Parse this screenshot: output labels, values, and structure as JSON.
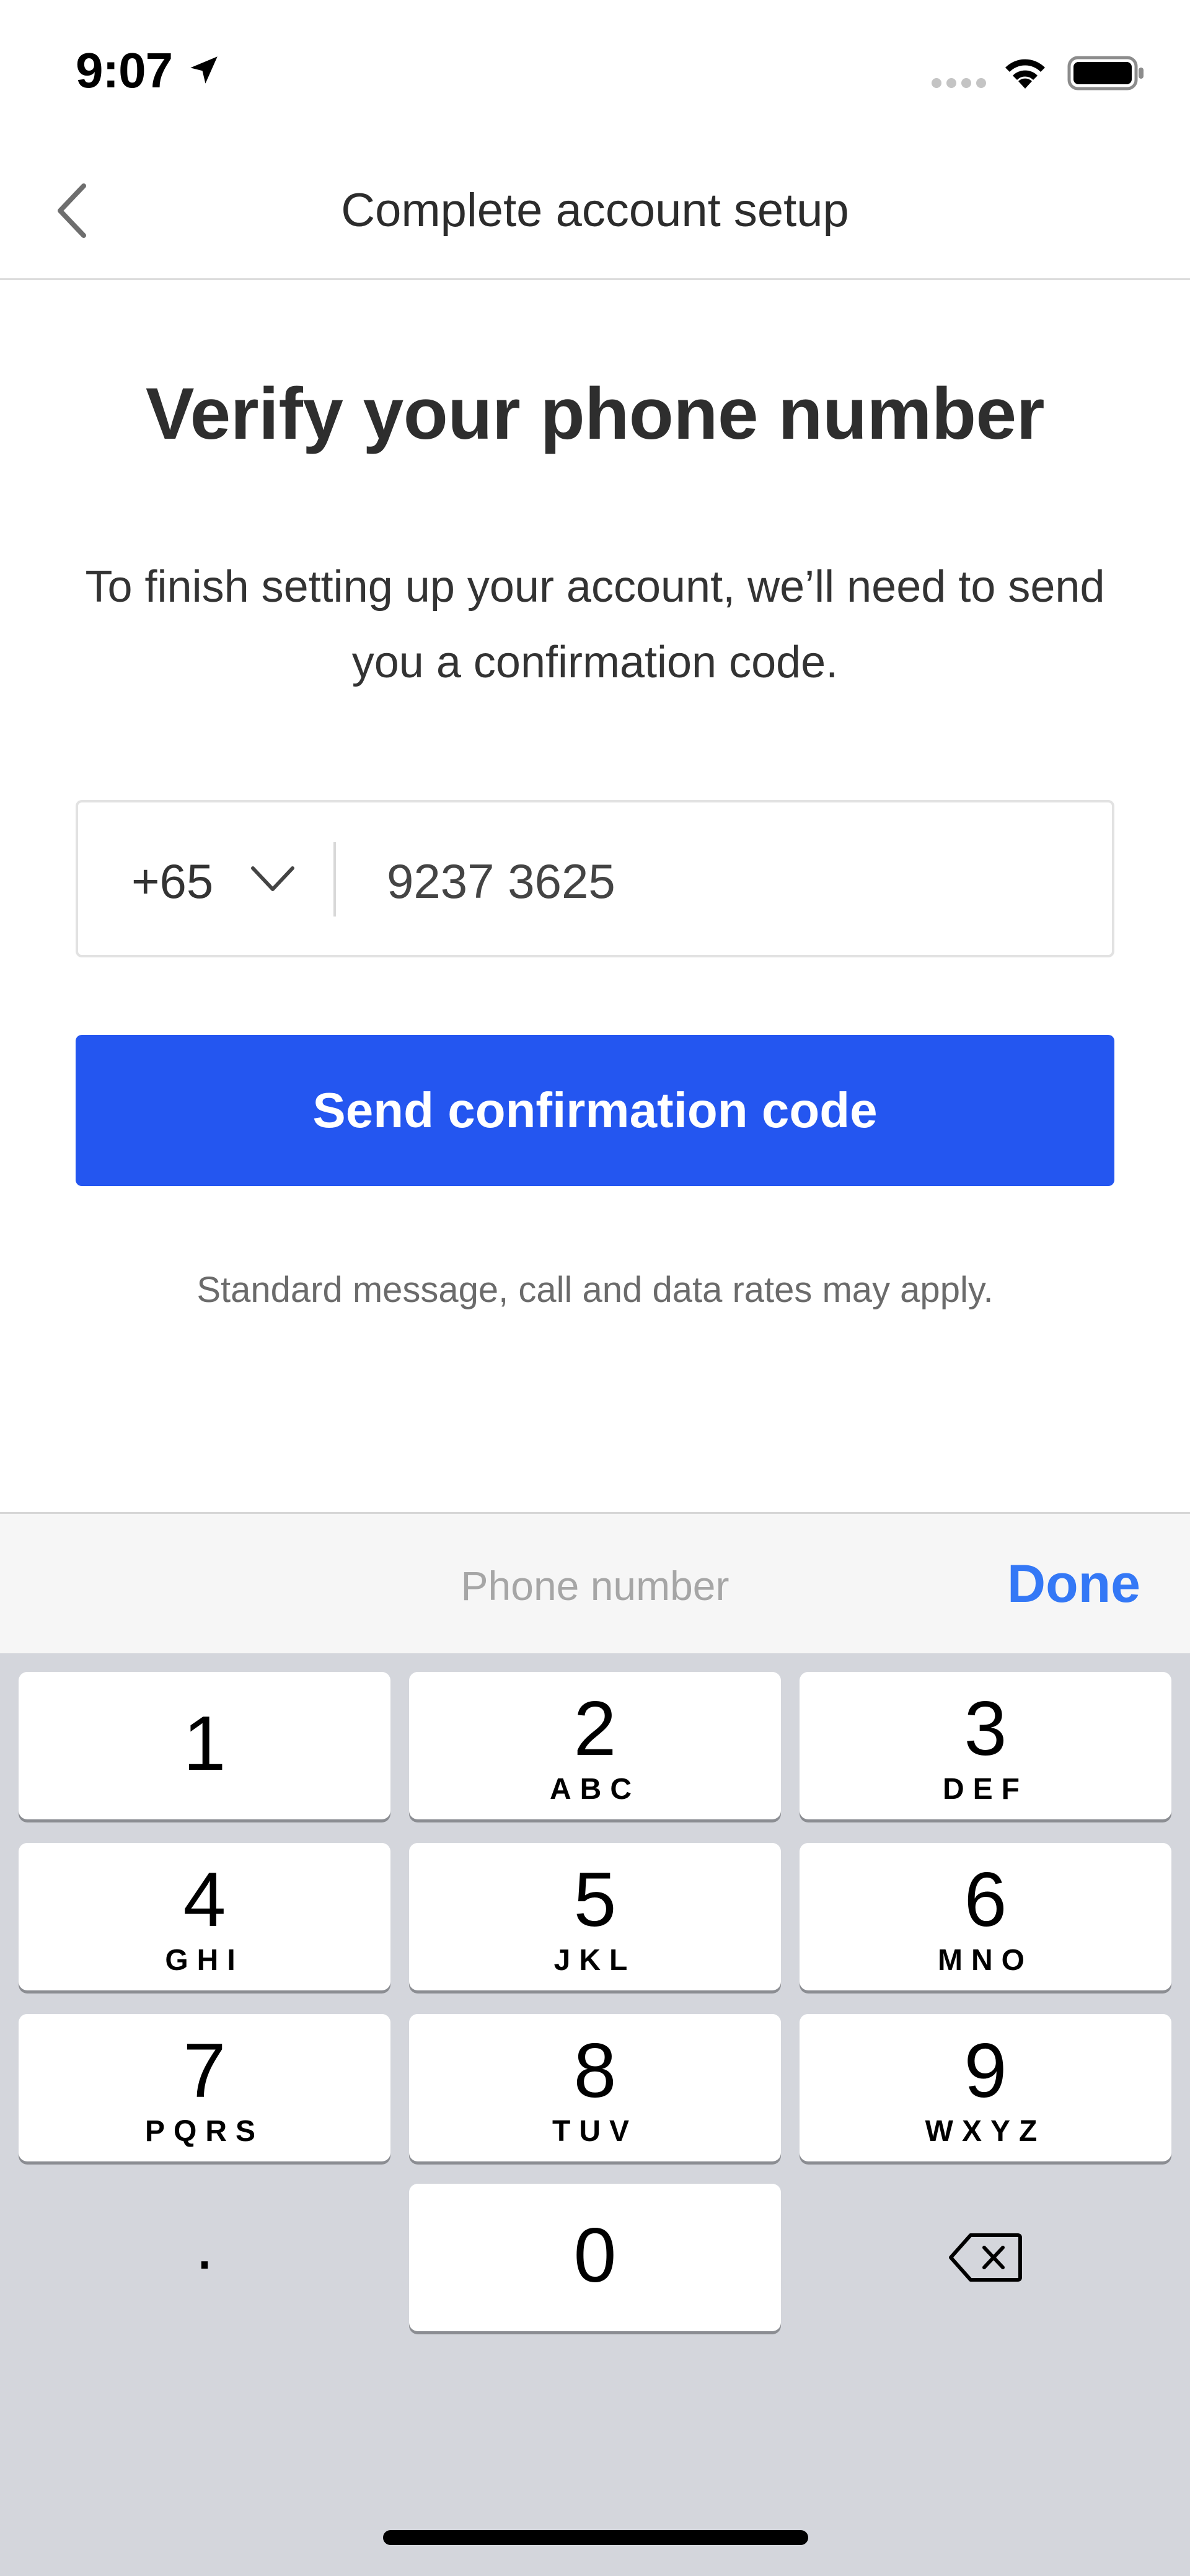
{
  "status_bar": {
    "time": "9:07",
    "icons": [
      "location-arrow-icon",
      "signal-dots-icon",
      "wifi-icon",
      "battery-icon"
    ]
  },
  "nav": {
    "back_icon": "chevron-left-icon",
    "title": "Complete account setup"
  },
  "main": {
    "heading": "Verify your phone number",
    "description": "To finish setting up your account, we’ll need to send you a confirmation code.",
    "phone": {
      "country_code": "+65",
      "number": "9237 3625"
    },
    "send_button_label": "Send confirmation code",
    "rates_note": "Standard message, call and data rates may apply."
  },
  "keyboard": {
    "accessory_label": "Phone number",
    "done_label": "Done",
    "keys": [
      {
        "digit": "1",
        "letters": ""
      },
      {
        "digit": "2",
        "letters": "ABC"
      },
      {
        "digit": "3",
        "letters": "DEF"
      },
      {
        "digit": "4",
        "letters": "GHI"
      },
      {
        "digit": "5",
        "letters": "JKL"
      },
      {
        "digit": "6",
        "letters": "MNO"
      },
      {
        "digit": "7",
        "letters": "PQRS"
      },
      {
        "digit": "8",
        "letters": "TUV"
      },
      {
        "digit": "9",
        "letters": "WXYZ"
      },
      {
        "digit": "0",
        "letters": ""
      }
    ],
    "period_label": ".",
    "delete_icon": "backspace-icon"
  },
  "colors": {
    "accent": "#2456f0",
    "done": "#3478f6",
    "keypad_bg": "#d4d6dc"
  }
}
